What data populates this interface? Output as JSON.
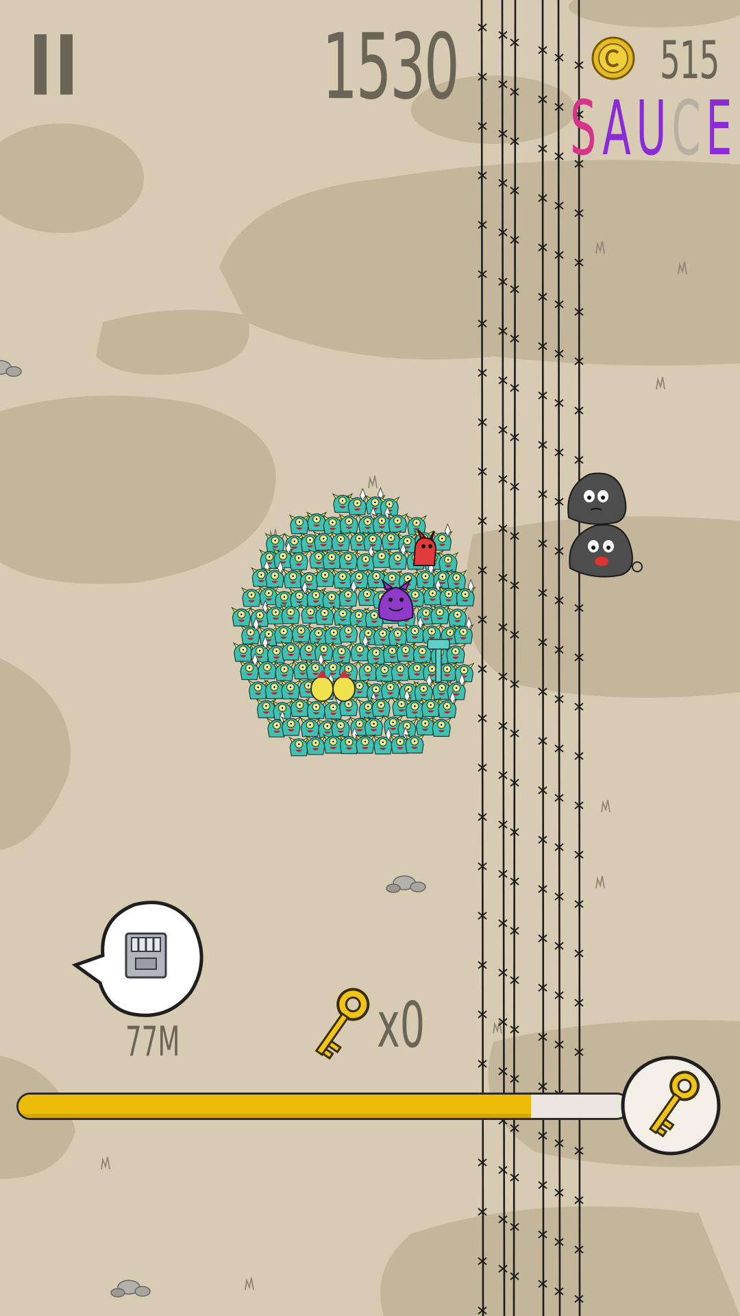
{
  "hud": {
    "score": "1530",
    "coins": "515",
    "pause_label": "Pause",
    "word": [
      {
        "char": "S",
        "color": "#d6338a"
      },
      {
        "char": "A",
        "color": "#8a2bd6"
      },
      {
        "char": "U",
        "color": "#8a2bd6"
      },
      {
        "char": "C",
        "color": "#b7b0a2"
      },
      {
        "char": "E",
        "color": "#8a2bd6"
      }
    ]
  },
  "next_item": {
    "icon": "door-icon",
    "distance": "77M"
  },
  "keys": {
    "icon": "golden-key-icon",
    "count": "x0"
  },
  "progress": {
    "fraction": 0.84,
    "goal_icon": "golden-key-icon"
  },
  "colors": {
    "ground": "#d7ccb3",
    "shadow": "#c3b69a",
    "accent_yellow": "#ecbc0a",
    "hud_text": "#6b6558",
    "monster_teal": "#40c0b0",
    "monster_yellow": "#e6e04a"
  }
}
